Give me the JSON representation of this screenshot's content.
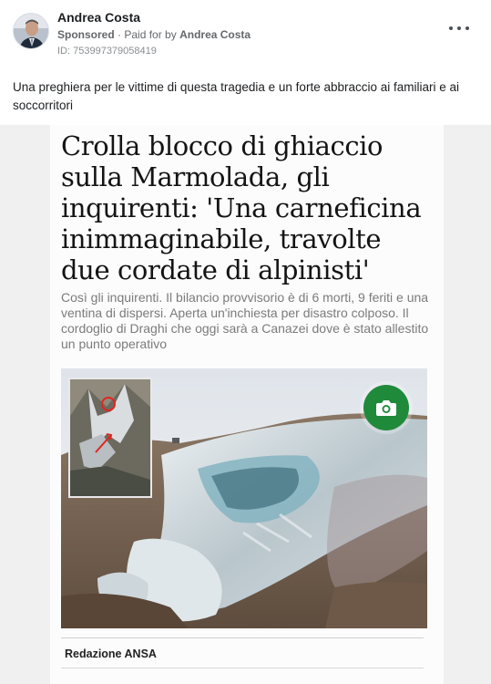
{
  "post": {
    "author": "Andrea Costa",
    "sponsored": "Sponsored",
    "separator": "·",
    "paid_for_prefix": "Paid for by",
    "paid_for_name": "Andrea Costa",
    "ad_id": "ID: 753997379058419",
    "more_icon": "more-horizontal-icon",
    "caption": "Una preghiera per le vittime di questa tragedia e un forte abbraccio ai familiari e ai soccorritori"
  },
  "article": {
    "headline": "Crolla blocco di ghiaccio sulla Marmolada, gli inquirenti: 'Una carneficina inimmaginabile, travolte due cordate di alpinisti'",
    "lede": "Così gli inquirenti. Il bilancio provvisorio è di 6 morti, 9 feriti e una ventina di dispersi. Aperta un'inchiesta per disastro colposo. Il cordoglio di Draghi che oggi sarà a Canazei dove è stato allestito un punto operativo",
    "byline": "Redazione ANSA",
    "camera_icon": "camera-icon",
    "camera_color": "#208a3b"
  }
}
